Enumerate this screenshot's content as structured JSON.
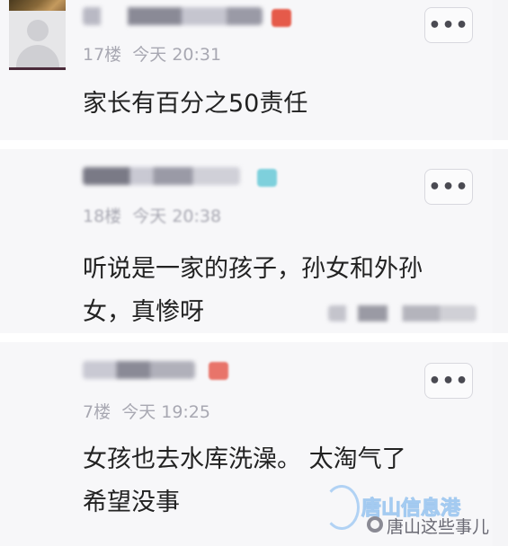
{
  "comments": [
    {
      "floor": "17楼",
      "time": "今天 20:31",
      "text": "家长有百分之50责任"
    },
    {
      "floor": "18楼",
      "time": "今天 20:38",
      "text": "听说是一家的孩子，孙女和外孙",
      "text2": "女，真惨呀"
    },
    {
      "floor": "7楼",
      "time": "今天 19:25",
      "text": "女孩也去水库洗澡。 太淘气了",
      "text2": "希望没事"
    }
  ],
  "more_label": "•••",
  "watermark": {
    "brand": "唐山信息港",
    "account": "唐山这些事儿"
  }
}
